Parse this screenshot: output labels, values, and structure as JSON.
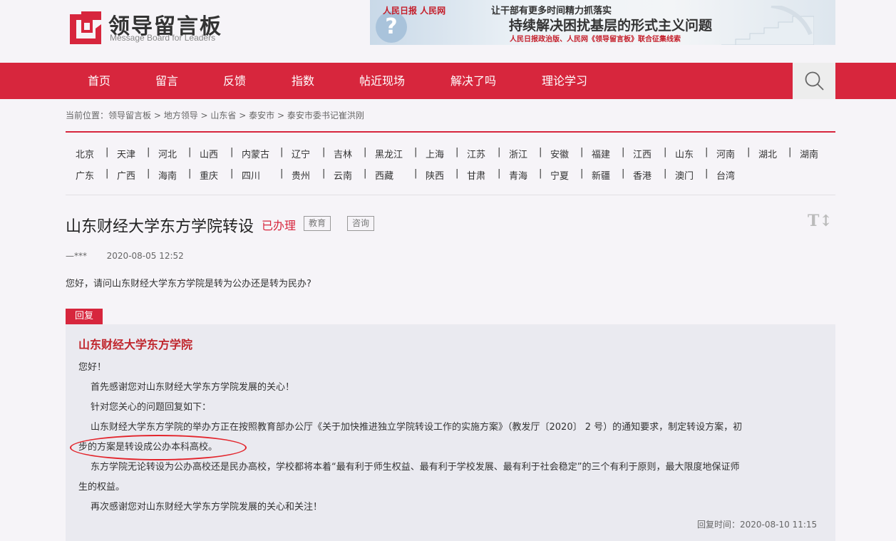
{
  "header": {
    "logo_title": "领导留言板",
    "logo_subtitle": "Message Board for Leaders",
    "banner": {
      "logos": "人民日报  人民网",
      "line1": "让干部有更多时间精力抓落实",
      "line2": "持续解决困扰基层的形式主义问题",
      "line3": "人民日报政治版、人民网《领导留言板》联合征集线索"
    }
  },
  "nav": {
    "items": [
      "首页",
      "留言",
      "反馈",
      "指数",
      "帖近现场",
      "解决了吗",
      "理论学习"
    ],
    "search_icon": "search-icon"
  },
  "breadcrumb": {
    "prefix": "当前位置：",
    "items": [
      "领导留言板",
      "地方领导",
      "山东省",
      "泰安市",
      "泰安市委书记崔洪刚"
    ],
    "separator": " > "
  },
  "provinces": {
    "row1": [
      "北京",
      "天津",
      "河北",
      "山西",
      "内蒙古",
      "辽宁",
      "吉林",
      "黑龙江",
      "上海",
      "江苏",
      "浙江",
      "安徽",
      "福建",
      "江西",
      "山东",
      "河南",
      "湖北",
      "湖南"
    ],
    "row2": [
      "广东",
      "广西",
      "海南",
      "重庆",
      "四川",
      "贵州",
      "云南",
      "西藏",
      "陕西",
      "甘肃",
      "青海",
      "宁夏",
      "新疆",
      "香港",
      "澳门",
      "台湾"
    ]
  },
  "message": {
    "title": "山东财经大学东方学院转设",
    "status": "已办理",
    "tags": [
      "教育",
      "咨询"
    ],
    "font_toggle": "T↕",
    "author": "—***",
    "date": "2020-08-05 12:52",
    "content": "您好，请问山东财经大学东方学院是转为公办还是转为民办?"
  },
  "reply": {
    "label": "回复",
    "org": "山东财经大学东方学院",
    "greeting": "您好！",
    "p1": "首先感谢您对山东财经大学东方学院发展的关心！",
    "p2": "针对您关心的问题回复如下：",
    "p3_a": "山东财经大学东方学院的举办方正在按照教育部办公厅《关于加快推进独立学院转设工作的实施方案》（教发厅〔2020〕 2 号）的通知要求，制定转设方案，初",
    "p3_b": "步的方案是转设成公办本科高校。",
    "p4_a": "东方学院无论转设为公办高校还是民办高校，学校都将本着“最有利于师生权益、最有利于学校发展、最有利于社会稳定”的三个有利于原则，最大限度地保证师",
    "p4_b": "生的权益。",
    "p5": "再次感谢您对山东财经大学东方学院发展的关心和关注！",
    "time": "回复时间：2020-08-10 11:15"
  },
  "colors": {
    "brand_red": "#d7263d",
    "reply_bg": "#eaeaf0",
    "page_bg": "#f6f4f8",
    "annotation_circle": "#e3242b"
  }
}
